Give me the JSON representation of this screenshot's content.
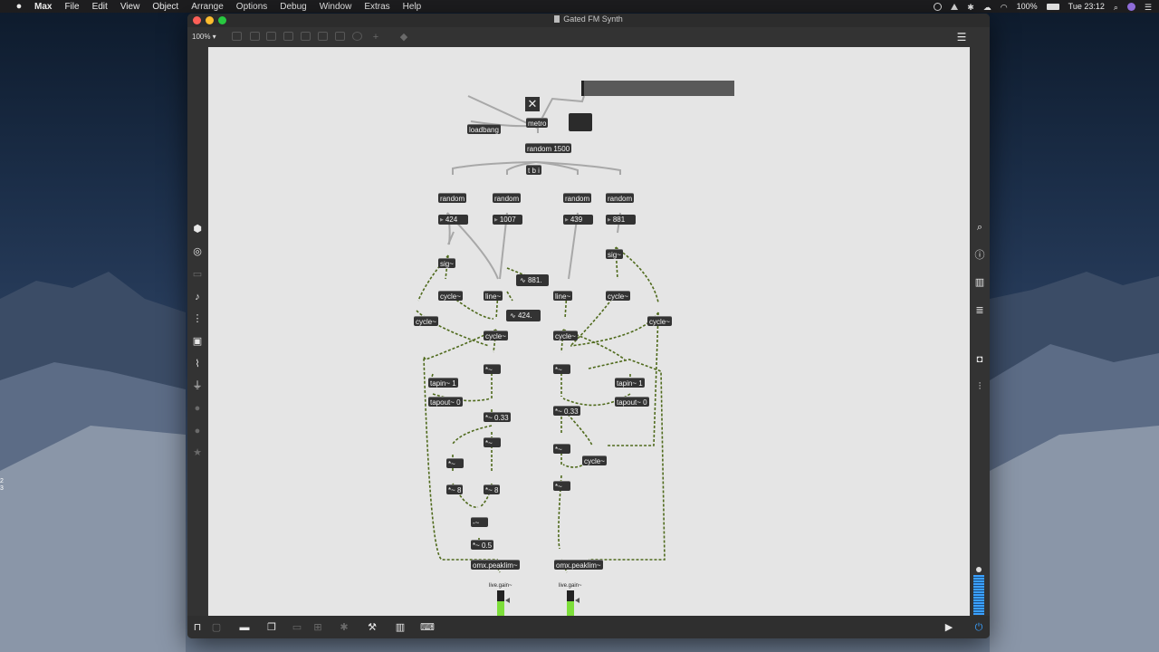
{
  "menubar": {
    "apple": "",
    "app": "Max",
    "items": [
      "File",
      "Edit",
      "View",
      "Object",
      "Arrange",
      "Options",
      "Debug",
      "Window",
      "Extras",
      "Help"
    ],
    "battery": "100%",
    "clock": "Tue 23:12"
  },
  "desktop_numbers": [
    "2",
    "3"
  ],
  "window": {
    "title": "Gated FM Synth",
    "zoom": "100% ▾"
  },
  "patch": {
    "objects": {
      "metro": "metro",
      "loadbang": "loadbang",
      "random1500": "random 1500",
      "tbi": "t b i",
      "random_a": "random",
      "random_b": "random",
      "random_c": "random",
      "random_d": "random",
      "sig_l": "sig~",
      "sig_r": "sig~",
      "cycle1": "cycle~",
      "cycle2": "cycle~",
      "cycle3": "cycle~",
      "cycle4": "cycle~",
      "cycle5": "cycle~",
      "cycle6": "cycle~",
      "cycle7": "cycle~",
      "line1": "line~",
      "line2": "line~",
      "mul1": "*~",
      "mul2": "*~",
      "mul033a": "*~ 0.33",
      "mul033b": "*~ 0.33",
      "mul3": "*~",
      "mul4": "*~",
      "mul5": "*~",
      "mul6": "*~",
      "mul8a": "*~ 8",
      "mul8b": "*~ 8",
      "plus": "-~",
      "mul05": "*~ 0.5",
      "tapin_l": "tapin~ 1",
      "tapout_l": "tapout~ 0",
      "tapin_r": "tapin~ 1",
      "tapout_r": "tapout~ 0",
      "peaklim_l": "omx.peaklim~",
      "peaklim_r": "omx.peaklim~",
      "livegain_l": "live.gain~",
      "livegain_r": "live.gain~"
    },
    "numbers": {
      "n1": "424",
      "n2": "1007",
      "n3": "439",
      "n4": "881"
    },
    "signals": {
      "s1": "881.",
      "s2": "424."
    }
  }
}
